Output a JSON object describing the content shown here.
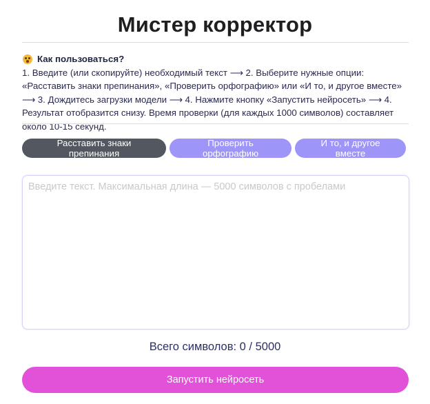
{
  "header": {
    "title": "Мистер корректор"
  },
  "howto": {
    "heading": "Как пользоваться?",
    "heading_icon": "thinking-face-emoji-icon",
    "text": "1. Введите (или скопируйте) необходимый текст ⟶ 2. Выберите нужные опции: «Расставить знаки препинания», «Проверить орфографию» или «И то, и другое вместе» ⟶ 3. Дождитесь загрузки модели ⟶ 4. Нажмите кнопку «Запустить нейросеть» ⟶ 4. Результат отобразится снизу. Время проверки (для каждых 1000 символов) составляет около 10-15 секунд."
  },
  "options": {
    "punctuation_label": "Расставить знаки препинания",
    "spelling_label": "Проверить орфографию",
    "both_label": "И то, и другое вместе",
    "selected": "punctuation"
  },
  "editor": {
    "value": "",
    "placeholder": "Введите текст. Максимальная длина — 5000 символов с пробелами"
  },
  "counter": {
    "text": "Всего символов: 0 / 5000"
  },
  "run_button": {
    "label": "Запустить нейросеть"
  },
  "colors": {
    "active_option": "#525760",
    "inactive_option": "#9d95f7",
    "run_button": "#e152d8",
    "title_text": "#1f1f22"
  }
}
